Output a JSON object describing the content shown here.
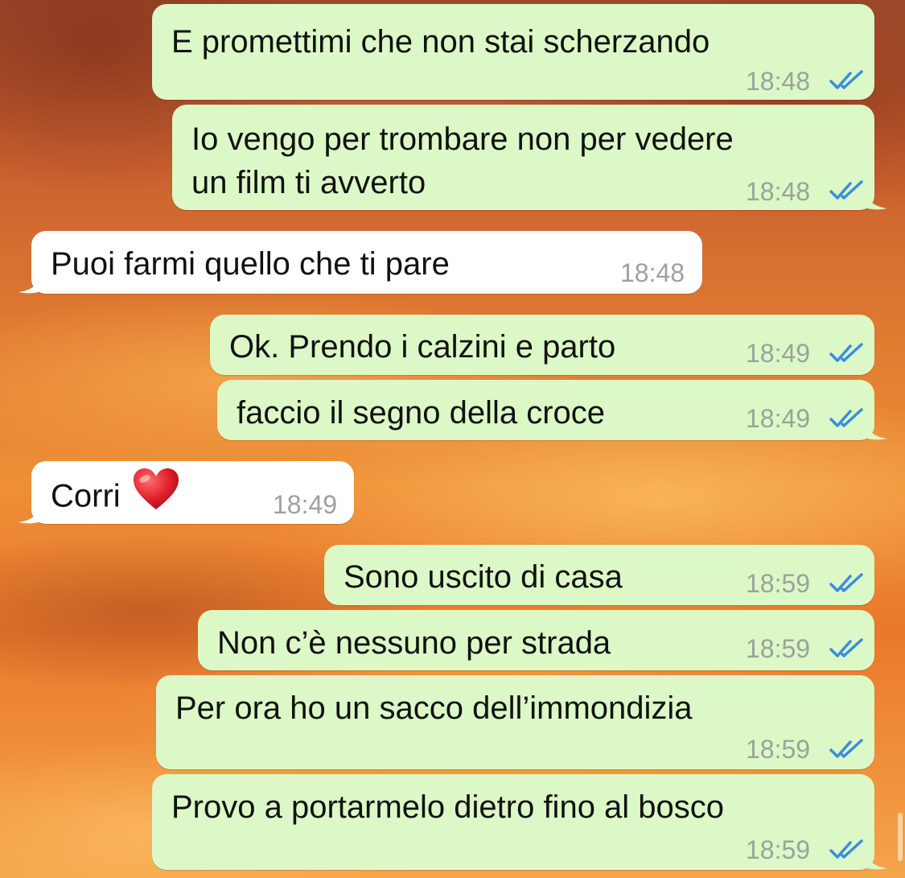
{
  "conversation": {
    "messages": [
      {
        "direction": "outgoing",
        "text": "E promettimi che non stai scherzando",
        "time": "18:48",
        "status": "read"
      },
      {
        "direction": "outgoing",
        "text_lines": [
          "Io vengo per trombare non per vedere",
          "un film ti avverto"
        ],
        "time": "18:48",
        "status": "read"
      },
      {
        "direction": "incoming",
        "text": "Puoi farmi quello che ti pare",
        "time": "18:48"
      },
      {
        "direction": "outgoing",
        "text": "Ok. Prendo i calzini e parto",
        "time": "18:49",
        "status": "read"
      },
      {
        "direction": "outgoing",
        "text": "faccio il segno della croce",
        "time": "18:49",
        "status": "read"
      },
      {
        "direction": "incoming",
        "text": "Corri",
        "emoji": "heart-emoji",
        "time": "18:49"
      },
      {
        "direction": "outgoing",
        "text": "Sono uscito di casa",
        "time": "18:59",
        "status": "read"
      },
      {
        "direction": "outgoing",
        "text": "Non c’è nessuno per strada",
        "time": "18:59",
        "status": "read"
      },
      {
        "direction": "outgoing",
        "text": "Per ora ho un sacco dell’immondizia",
        "time": "18:59",
        "status": "read"
      },
      {
        "direction": "outgoing",
        "text": "Provo a portarmelo dietro fino al bosco",
        "time": "18:59",
        "status": "read"
      }
    ]
  },
  "colors": {
    "outgoing_bubble": "#dcf8c6",
    "incoming_bubble": "#ffffff",
    "read_ticks": "#3b8de0",
    "timestamp": "#9aa39a"
  },
  "icons": {
    "read_status": "double-check-icon",
    "emoji": "heart-emoji"
  }
}
